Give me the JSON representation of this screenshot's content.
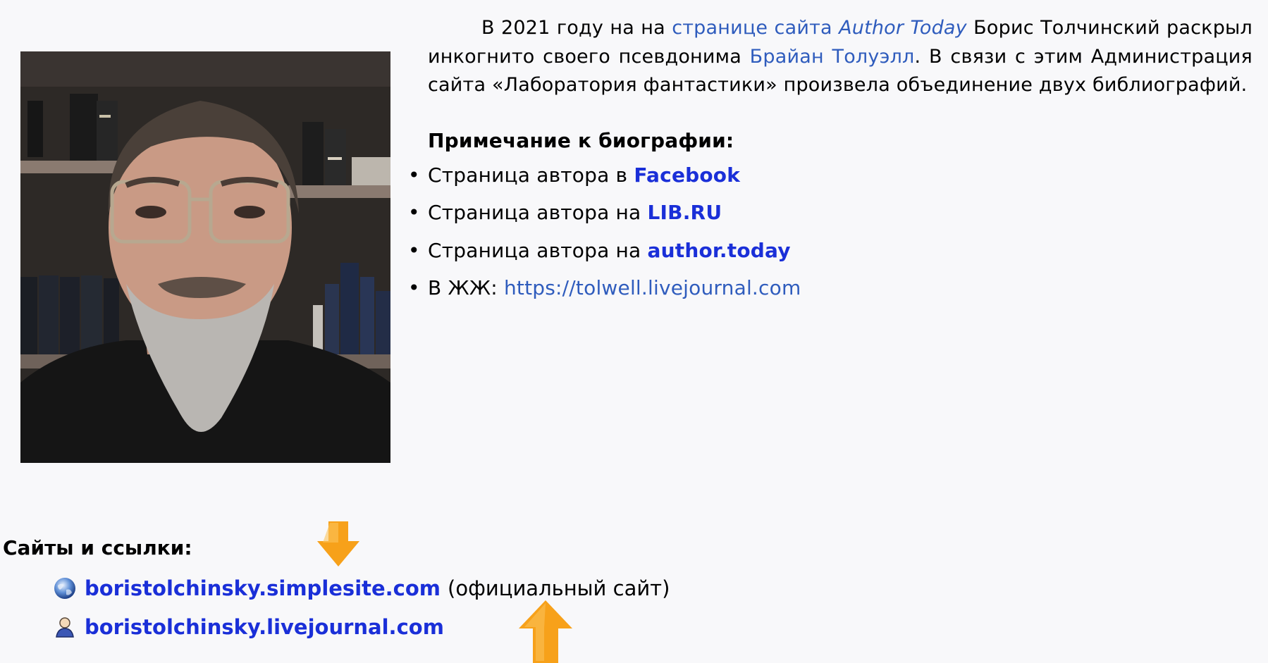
{
  "bio": {
    "para_start": "В 2021 году на на ",
    "link1_text": "странице сайта ",
    "link1_italic": "Author Today",
    "para_mid1": " Борис Толчинский раскрыл инкогнито своего псевдонима ",
    "link2_text": "Брайан Толуэлл",
    "para_end": ". В связи с этим Администрация сайта «Лаборатория фантастики» произвела объединение двух библиографий."
  },
  "note": {
    "title": "Примечание к биографии:",
    "items": [
      {
        "prefix": "Страница автора в ",
        "link": "Facebook"
      },
      {
        "prefix": "Страница автора на ",
        "link": "LIB.RU"
      },
      {
        "prefix": "Страница автора на ",
        "link": "author.today"
      },
      {
        "prefix": "В ЖЖ: ",
        "link": "https://tolwell.livejournal.com"
      }
    ]
  },
  "sites": {
    "title": "Сайты и ссылки:",
    "items": [
      {
        "icon": "globe-icon",
        "link": "boristolchinsky.simplesite.com",
        "note": "(официальный сайт)"
      },
      {
        "icon": "user-icon",
        "link": "boristolchinsky.livejournal.com",
        "note": ""
      }
    ]
  },
  "colors": {
    "background": "#f8f8fa",
    "link_blue": "#2f5cbd",
    "strong_link_blue": "#1a2fd8",
    "arrow_orange": "#f7a11a"
  }
}
